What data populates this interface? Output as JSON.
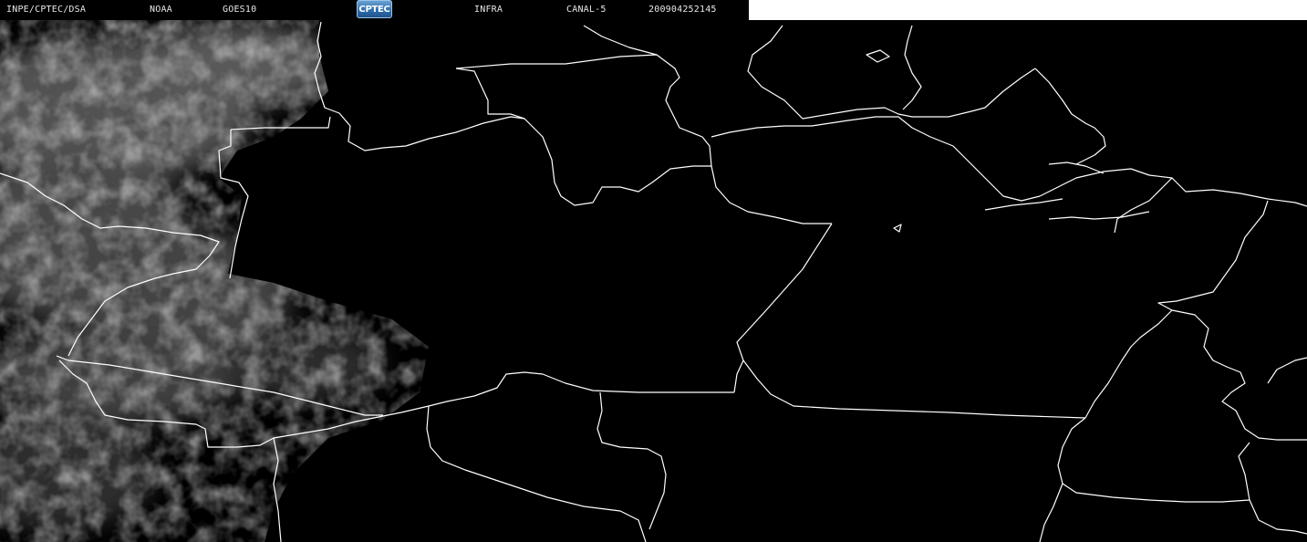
{
  "header": {
    "institution": "INPE/CPTEC/DSA",
    "agency": "NOAA",
    "satellite": "GOES10",
    "logo_text": "CPTEC",
    "band": "INFRA",
    "channel": "CANAL-5",
    "timestamp": "200904252145"
  },
  "colors": {
    "background": "#000000",
    "borders": "#ffffff",
    "clouds": "#8a8a8a",
    "header_text": "#e8e8e8"
  },
  "icons": {
    "logo": "cptec-logo"
  }
}
